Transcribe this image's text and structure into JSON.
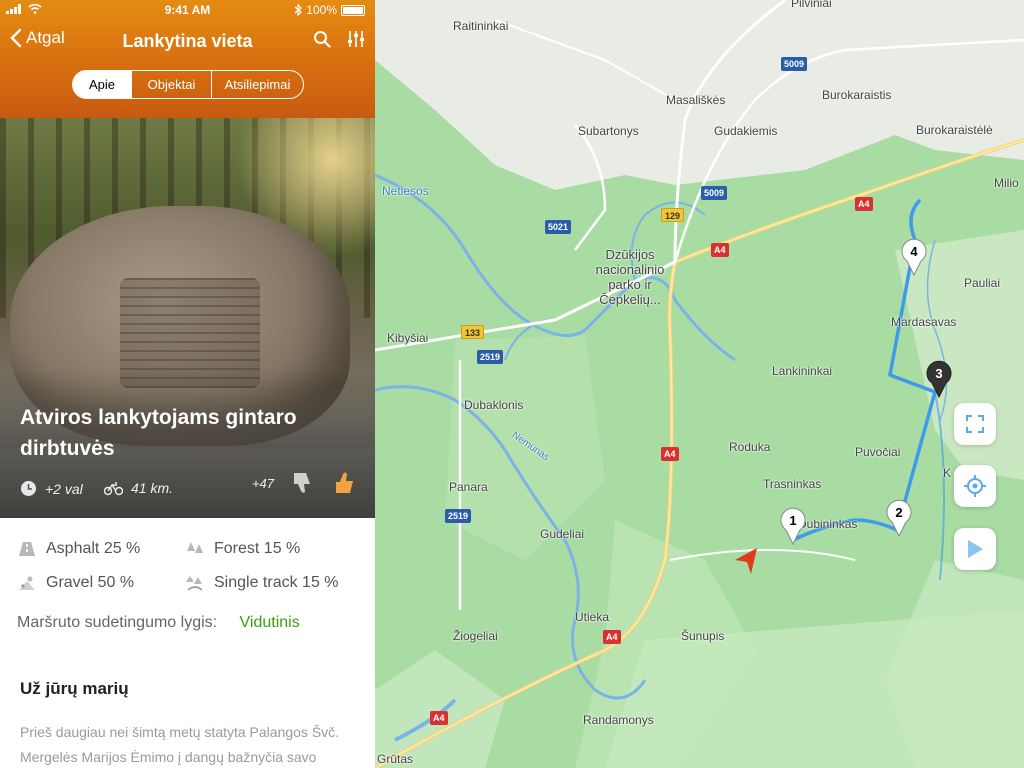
{
  "status_bar": {
    "time": "9:41 AM",
    "battery": "100%"
  },
  "navbar": {
    "back_label": "Atgal",
    "title": "Lankytina vieta"
  },
  "tabs": [
    "Apie",
    "Objektai",
    "Atsiliepimai"
  ],
  "place": {
    "title": "Atviros lankytojams gintaro dirbtuvės",
    "duration": "+2 val",
    "distance": "41 km.",
    "likes": "+47"
  },
  "surfaces": [
    {
      "label": "Asphalt 25 %",
      "icon": "asphalt-icon"
    },
    {
      "label": "Forest 15 %",
      "icon": "forest-icon"
    },
    {
      "label": "Gravel 50 %",
      "icon": "gravel-icon"
    },
    {
      "label": "Single track 15 %",
      "icon": "single-track-icon"
    }
  ],
  "difficulty": {
    "label": "Maršruto sudetingumo lygis:",
    "value": "Vidutinis"
  },
  "section": {
    "title": "Už jūrų marių",
    "text": "Prieš daugiau nei šimtą metų statyta Palangos Švč. Mergelės Marijos Ėmimo į dangų bažnyčia savo"
  },
  "map": {
    "places": {
      "raitininkai": "Raitininkai",
      "pilviniai": "Pilviniai",
      "masaliskes": "Masališkės",
      "burokaraistis": "Burokaraistis",
      "subartonys": "Subartonys",
      "gudakiemis": "Gudakiemis",
      "burokaraistele": "Burokaraistėlė",
      "netiesos": "Netiesos",
      "milio": "Milio",
      "park": "Dzūkijos nacionalinio parko ir Čepkelių...",
      "pauliai": "Pauliai",
      "kibysiai": "Kibyšiai",
      "mardasavas": "Mardasavas",
      "lankininkai": "Lankininkai",
      "dubaklonis": "Dubaklonis",
      "nemunas": "Nemunas",
      "roduka": "Roduka",
      "puvociai": "Puvočiai",
      "k": "K",
      "trasninkas": "Trasninkas",
      "panara": "Panara",
      "dubininkas": "Dubininkas",
      "gudeliai": "Gudeliai",
      "utieka": "Utieka",
      "ziogeliai": "Žiogeliai",
      "sunupis": "Šunupis",
      "randamonys": "Randamonys",
      "grutas": "Grūtas"
    },
    "roads": {
      "r5009a": "5009",
      "r5009b": "5009",
      "r129": "129",
      "r5021": "5021",
      "a4a": "A4",
      "a4b": "A4",
      "a4c": "A4",
      "a4d": "A4",
      "a4e": "A4",
      "r133": "133",
      "r2519a": "2519",
      "r2519b": "2519"
    },
    "pins": [
      "1",
      "2",
      "3",
      "4"
    ]
  }
}
